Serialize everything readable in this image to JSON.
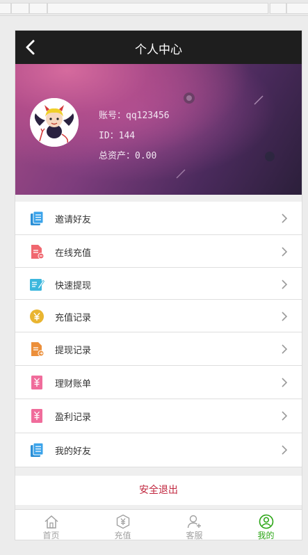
{
  "header": {
    "title": "个人中心"
  },
  "profile": {
    "account": "账号：qq123456",
    "id": "ID：144",
    "assets": "总资产：0.00"
  },
  "menu": [
    {
      "label": "邀请好友",
      "icon": "document-icon"
    },
    {
      "label": "在线充值",
      "icon": "file-minus-icon"
    },
    {
      "label": "快速提现",
      "icon": "edit-note-icon"
    },
    {
      "label": "充值记录",
      "icon": "yen-coin-icon"
    },
    {
      "label": "提现记录",
      "icon": "file-transfer-icon"
    },
    {
      "label": "理财账单",
      "icon": "yen-bill-icon"
    },
    {
      "label": "盈利记录",
      "icon": "yen-bill-icon"
    },
    {
      "label": "我的好友",
      "icon": "document-icon"
    }
  ],
  "logout": {
    "label": "安全退出"
  },
  "tabs": [
    {
      "label": "首页",
      "icon": "home-icon"
    },
    {
      "label": "充值",
      "icon": "yen-hexagon-icon"
    },
    {
      "label": "客服",
      "icon": "user-plus-icon"
    },
    {
      "label": "我的",
      "icon": "user-circle-icon",
      "active": true
    }
  ],
  "colors": {
    "accent": "#2aa514",
    "logout": "#c0253d",
    "header": "#1e1e1e"
  }
}
